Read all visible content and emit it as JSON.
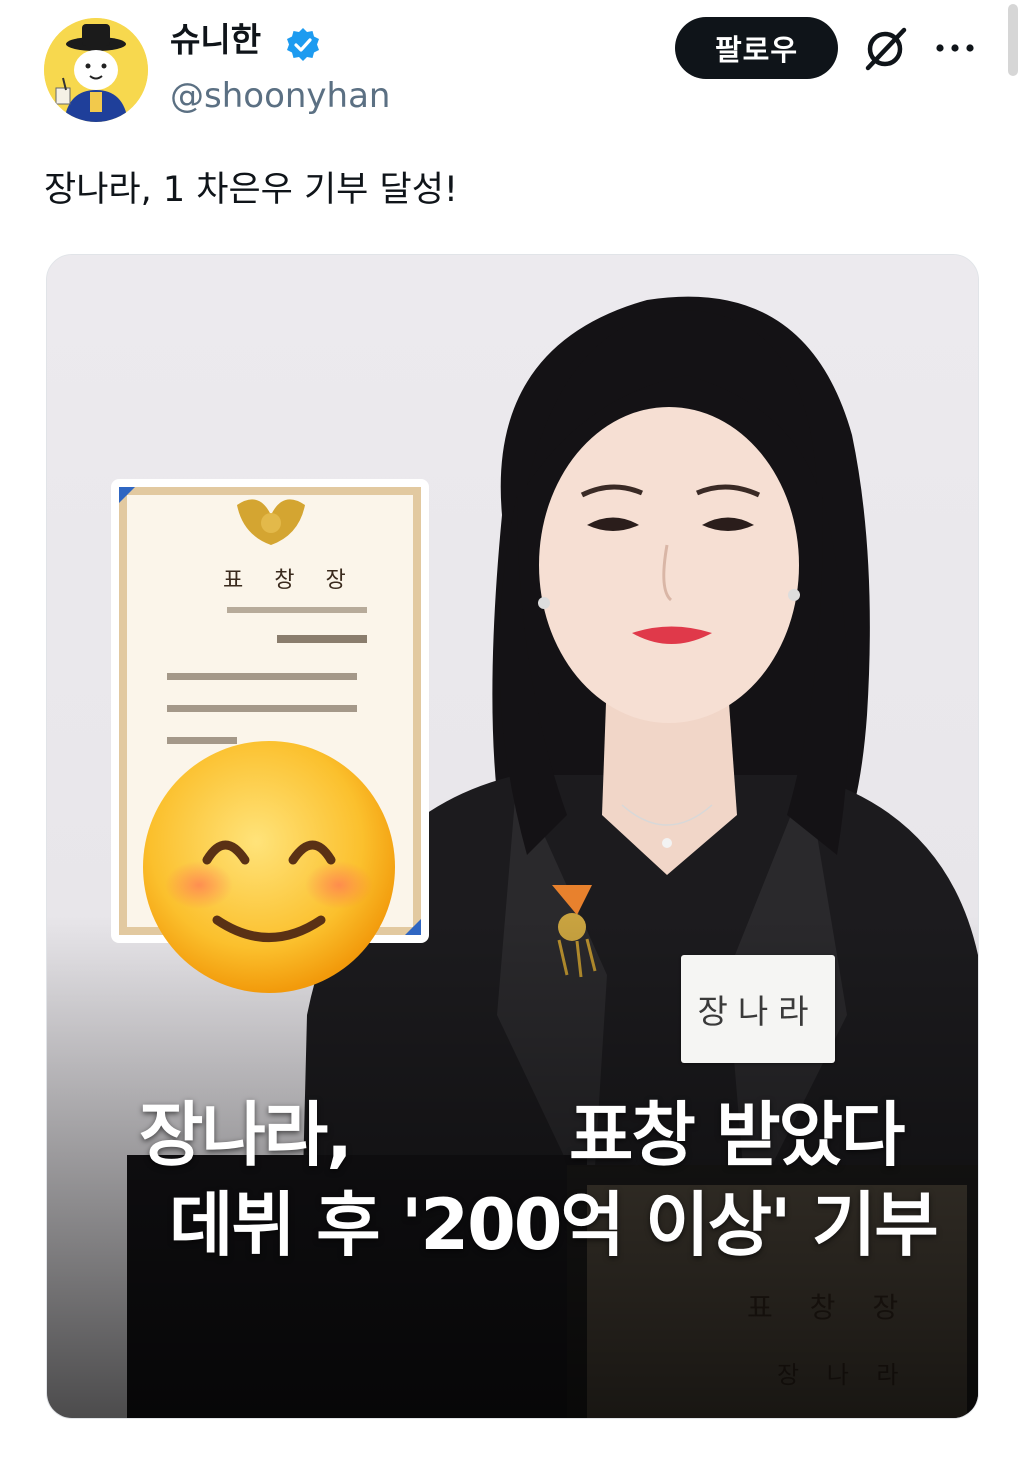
{
  "header": {
    "display_name": "슈니한",
    "handle": "@shoonyhan",
    "follow_label": "팔로우",
    "verified_icon": "verified-badge-icon",
    "grok_icon": "grok-icon",
    "more_icon": "more-icon",
    "accent_color": "#1d9bf0"
  },
  "tweet": {
    "text": "장나라, 1 차은우 기부 달성!"
  },
  "media": {
    "caption_line1_left": "장나라,",
    "caption_line1_right": "표창 받았다",
    "caption_line2": "데뷔 후 '200억 이상' 기부",
    "name_tag": "장나라",
    "certificate_title": "표 창 장",
    "certificate_name": "장 나 라",
    "emoji": "smiling-face-emoji"
  }
}
